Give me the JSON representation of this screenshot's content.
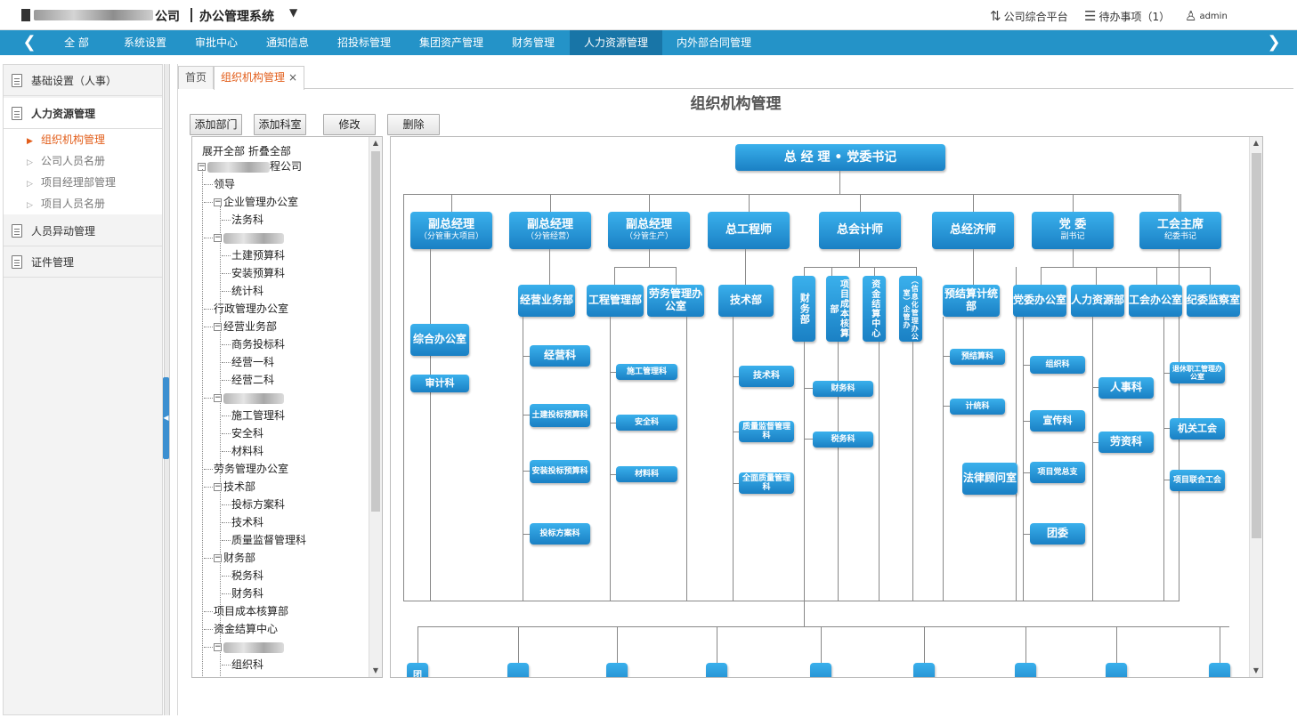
{
  "header": {
    "company_suffix": "公司",
    "system_name": "办公管理系统",
    "caret": "▼",
    "links": [
      {
        "label": "公司综合平台",
        "icon": "sort-arrows-icon"
      },
      {
        "label": "待办事项（1）",
        "icon": "checklist-icon"
      },
      {
        "label": "admin",
        "icon": "user-icon"
      }
    ]
  },
  "nav": {
    "items": [
      "全 部",
      "系统设置",
      "审批中心",
      "通知信息",
      "招投标管理",
      "集团资产管理",
      "财务管理",
      "人力资源管理",
      "内外部合同管理"
    ],
    "active_index": 7
  },
  "sidebar": {
    "groups": [
      "基础设置（人事）",
      "人力资源管理",
      "人员异动管理",
      "证件管理"
    ],
    "active_group": 1,
    "sub_items": [
      "组织机构管理",
      "公司人员名册",
      "项目经理部管理",
      "项目人员名册"
    ],
    "active_sub": 0
  },
  "tabs": [
    {
      "label": "首页"
    },
    {
      "label": "组织机构管理",
      "close": "×"
    }
  ],
  "page_title": "组织机构管理",
  "toolbar": {
    "buttons": [
      "添加部门",
      "添加科室",
      "修改",
      "删除"
    ]
  },
  "tree": {
    "expand_all": "展开全部",
    "collapse_all": "折叠全部",
    "root_suffix": "程公司",
    "rows": [
      {
        "label": "领导",
        "level": 1,
        "toggle": ""
      },
      {
        "label": "企业管理办公室",
        "level": 1,
        "toggle": "-"
      },
      {
        "label": "法务科",
        "level": 2,
        "toggle": ""
      },
      {
        "label": "",
        "level": 1,
        "toggle": "-",
        "blurred": true
      },
      {
        "label": "土建预算科",
        "level": 2,
        "toggle": ""
      },
      {
        "label": "安装预算科",
        "level": 2,
        "toggle": ""
      },
      {
        "label": "统计科",
        "level": 2,
        "toggle": ""
      },
      {
        "label": "行政管理办公室",
        "level": 1,
        "toggle": ""
      },
      {
        "label": "经营业务部",
        "level": 1,
        "toggle": "-"
      },
      {
        "label": "商务投标科",
        "level": 2,
        "toggle": ""
      },
      {
        "label": "经营一科",
        "level": 2,
        "toggle": ""
      },
      {
        "label": "经营二科",
        "level": 2,
        "toggle": ""
      },
      {
        "label": "",
        "level": 1,
        "toggle": "-",
        "blurred": true
      },
      {
        "label": "施工管理科",
        "level": 2,
        "toggle": ""
      },
      {
        "label": "安全科",
        "level": 2,
        "toggle": ""
      },
      {
        "label": "材料科",
        "level": 2,
        "toggle": ""
      },
      {
        "label": "劳务管理办公室",
        "level": 1,
        "toggle": ""
      },
      {
        "label": "技术部",
        "level": 1,
        "toggle": "-"
      },
      {
        "label": "投标方案科",
        "level": 2,
        "toggle": ""
      },
      {
        "label": "技术科",
        "level": 2,
        "toggle": ""
      },
      {
        "label": "质量监督管理科",
        "level": 2,
        "toggle": ""
      },
      {
        "label": "财务部",
        "level": 1,
        "toggle": "-"
      },
      {
        "label": "税务科",
        "level": 2,
        "toggle": ""
      },
      {
        "label": "财务科",
        "level": 2,
        "toggle": ""
      },
      {
        "label": "项目成本核算部",
        "level": 1,
        "toggle": ""
      },
      {
        "label": "资金结算中心",
        "level": 1,
        "toggle": ""
      },
      {
        "label": "",
        "level": 1,
        "toggle": "-",
        "blurred": true
      },
      {
        "label": "组织科",
        "level": 2,
        "toggle": ""
      }
    ]
  },
  "org_chart": {
    "top": "总 经 理  •  党委书记",
    "level2": [
      {
        "label": "副总经理",
        "sub": "（分管重大项目）"
      },
      {
        "label": "副总经理",
        "sub": "（分管经营）"
      },
      {
        "label": "副总经理",
        "sub": "（分管生产）"
      },
      {
        "label": "总工程师",
        "sub": ""
      },
      {
        "label": "总会计师",
        "sub": ""
      },
      {
        "label": "总经济师",
        "sub": ""
      },
      {
        "label": "党  委",
        "sub": "副书记"
      },
      {
        "label": "工会主席",
        "sub": "纪委书记"
      }
    ],
    "depts": {
      "zonghe": "综合办公室",
      "shenji": "审计科",
      "jingying_bu": "经营业务部",
      "gongcheng_bu": "工程管理部",
      "laowu": "劳务管理办公室",
      "jishu_bu": "技术部",
      "caiwu_bu": "财务部",
      "chengben": "项目成本核算部",
      "zijin": "资金结算中心",
      "xinxi": "（信息化管理办公室）企管办",
      "yujiesuan_bu": "预结算计统部",
      "dangwei_ban": "党委办公室",
      "renli": "人力资源部",
      "gonghui_ban": "工会办公室",
      "jiwei": "纪委监察室"
    },
    "sections": {
      "jingying_ke": "经营科",
      "tujian_tb": "土建投标预算科",
      "anzhuang_tb": "安装投标预算科",
      "toubiao_fa": "投标方案科",
      "shigong": "施工管理科",
      "anquan": "安全科",
      "cailiao": "材料科",
      "jishu_ke": "技术科",
      "zhiliang": "质量监督管理科",
      "quanmian": "全面质量管理科",
      "caiwu_ke": "财务科",
      "shuiwu": "税务科",
      "yujiesuan_ke": "预结算科",
      "jitong": "计统科",
      "falv": "法律顾问室",
      "zuzhi": "组织科",
      "xuanchuan": "宣传科",
      "dangzongzhi": "项目党总支",
      "tuanwei": "团委",
      "renshi": "人事科",
      "laozi": "劳资科",
      "tuixiu": "退休职工管理办公室",
      "jiguan": "机关工会",
      "lianhe": "项目联合工会",
      "bottom_first": "团"
    }
  },
  "colors": {
    "nav_bg": "#2493c8",
    "nav_active": "#1875a7",
    "accent_orange": "#e25d19",
    "org_box": "#2a98d8"
  }
}
